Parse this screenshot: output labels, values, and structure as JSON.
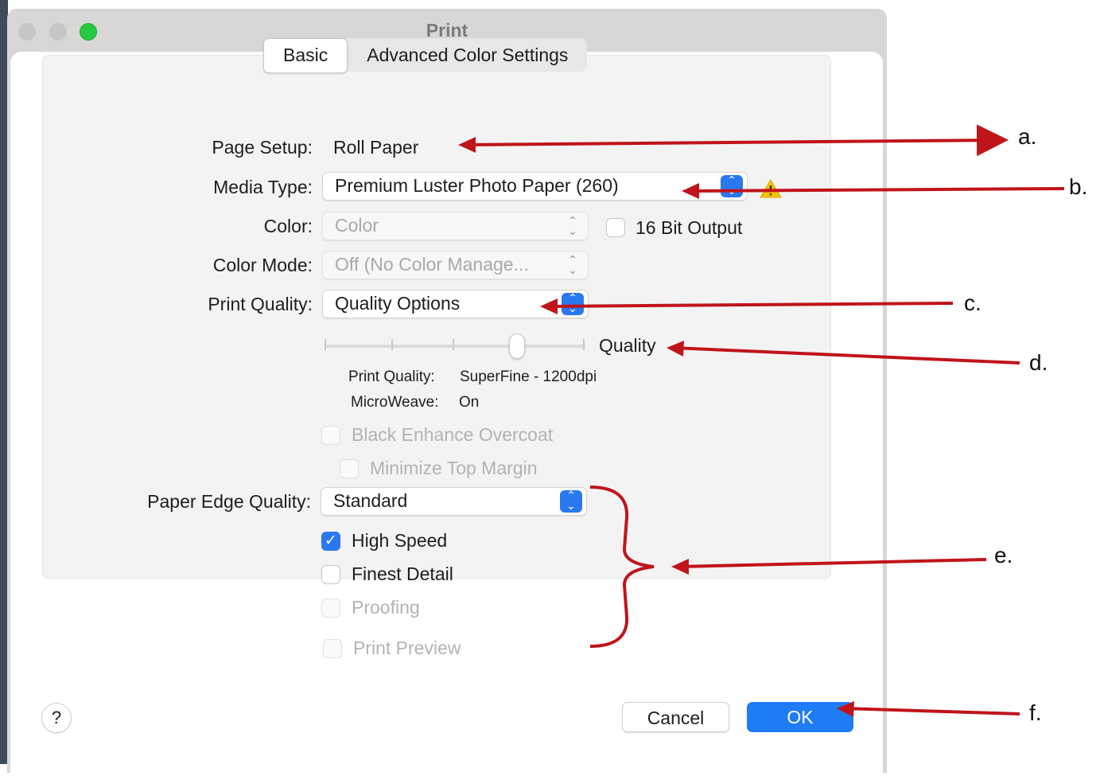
{
  "window": {
    "title": "Print"
  },
  "tabs": [
    {
      "label": "Basic",
      "active": true
    },
    {
      "label": "Advanced Color Settings",
      "active": false
    }
  ],
  "page_setup": {
    "label": "Page Setup:",
    "value": "Roll Paper"
  },
  "media_type": {
    "label": "Media Type:",
    "value": "Premium Luster Photo Paper (260)",
    "warning_icon": "warning-icon"
  },
  "color": {
    "label": "Color:",
    "value": "Color",
    "enabled": false
  },
  "bit16": {
    "label": "16 Bit Output",
    "checked": false
  },
  "color_mode": {
    "label": "Color Mode:",
    "value": "Off (No Color Manage...",
    "enabled": false
  },
  "print_quality": {
    "label": "Print Quality:",
    "value": "Quality Options"
  },
  "quality_slider": {
    "label": "Quality",
    "position_steps": 4,
    "current_step": 4
  },
  "quality_info": {
    "print_quality_label": "Print Quality:",
    "print_quality_value": "SuperFine - 1200dpi",
    "microweave_label": "MicroWeave:",
    "microweave_value": "On"
  },
  "black_enhance": {
    "label": "Black Enhance Overcoat",
    "checked": false,
    "enabled": false
  },
  "minimize_margin": {
    "label": "Minimize Top Margin",
    "checked": false,
    "enabled": false
  },
  "paper_edge": {
    "label": "Paper Edge Quality:",
    "value": "Standard"
  },
  "high_speed": {
    "label": "High Speed",
    "checked": true
  },
  "finest_detail": {
    "label": "Finest Detail",
    "checked": false
  },
  "proofing": {
    "label": "Proofing",
    "checked": false,
    "enabled": false
  },
  "print_preview": {
    "label": "Print Preview",
    "checked": false,
    "enabled": false
  },
  "buttons": {
    "help": "?",
    "cancel": "Cancel",
    "ok": "OK"
  },
  "annotations": [
    "a.",
    "b.",
    "c.",
    "d.",
    "e.",
    "f."
  ],
  "colors": {
    "accent": "#2a78f0",
    "annotation_red": "#c0141b",
    "ok_button": "#1e7cf5"
  }
}
